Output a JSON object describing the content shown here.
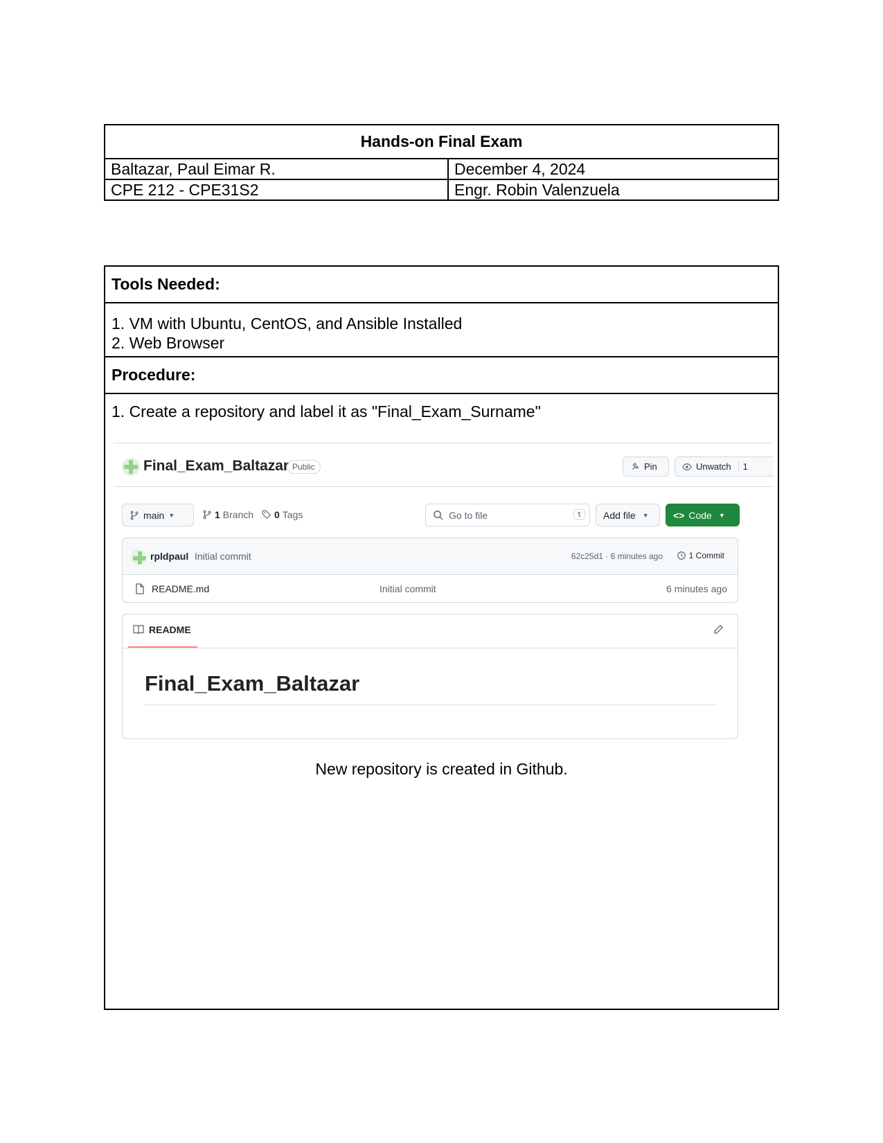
{
  "header": {
    "title": "Hands-on Final Exam",
    "student_name": "Baltazar, Paul Eimar R.",
    "date": "December 4, 2024",
    "course": "CPE 212 - CPE31S2",
    "instructor": "Engr. Robin Valenzuela"
  },
  "tools": {
    "heading": "Tools Needed:",
    "items": [
      "1. VM with Ubuntu, CentOS, and Ansible Installed",
      "2. Web Browser"
    ]
  },
  "procedure": {
    "heading": "Procedure:",
    "step1": "1. Create a repository and label it as \"Final_Exam_Surname\"",
    "caption": "New repository is created in Github."
  },
  "github": {
    "repo_name": "Final_Exam_Baltazar",
    "visibility": "Public",
    "pin_label": "Pin",
    "unwatch_label": "Unwatch",
    "watch_count": "1",
    "branch_selector": "main",
    "branch_count": "1",
    "branch_label": "Branch",
    "tag_count": "0",
    "tag_label": "Tags",
    "search_placeholder": "Go to file",
    "search_shortcut": "t",
    "add_file_label": "Add file",
    "code_label": "Code",
    "commit_user": "rpldpaul",
    "commit_message": "Initial commit",
    "commit_hash_time": "62c25d1 · 6 minutes ago",
    "commit_count": "1 Commit",
    "files": [
      {
        "name": "README.md",
        "message": "Initial commit",
        "time": "6 minutes ago"
      }
    ],
    "readme_tab": "README",
    "readme_heading": "Final_Exam_Baltazar",
    "accent_green": "#1f883d",
    "tab_underline": "#fd8c73"
  }
}
